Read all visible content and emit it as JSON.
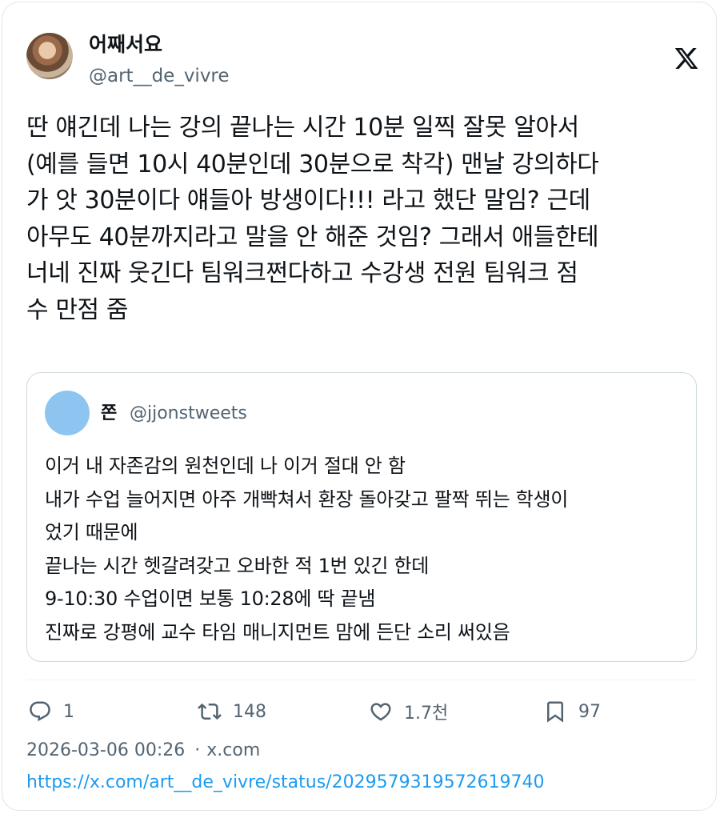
{
  "author": {
    "display_name": "어째서요",
    "handle": "@art__de_vivre"
  },
  "tweet": {
    "text": "딴 얘긴데 나는 강의 끝나는 시간 10분 일찍 잘못 알아서\n(예를 들면 10시 40분인데 30분으로 착각) 맨날 강의하다\n가 앗 30분이다 얘들아 방생이다!!! 라고 했단 말임? 근데\n아무도 40분까지라고 말을 안 해준 것임? 그래서 애들한테\n너네 진짜 웃긴다 팀워크쩐다하고 수강생 전원 팀워크 점\n수 만점 줌"
  },
  "quoted": {
    "display_name": "쫀",
    "handle": "@jjonstweets",
    "text": "이거 내 자존감의 원천인데 나 이거 절대 안 함\n내가 수업 늘어지면 아주 개빡쳐서 환장 돌아갖고 팔짝 뛰는 학생이\n었기 때문에\n끝나는 시간 헷갈려갖고 오바한 적 1번 있긴 한데\n9-10:30 수업이면 보통 10:28에 딱 끝냄\n진짜로 강평에 교수 타임 매니지먼트 맘에 든단 소리 써있음"
  },
  "actions": {
    "reply_count": "1",
    "retweet_count": "148",
    "like_count": "1.7천",
    "bookmark_count": "97"
  },
  "meta": {
    "timestamp": "2026-03-06 00:26",
    "separator": "·",
    "source": "x.com",
    "url": "https://x.com/art__de_vivre/status/2029579319572619740"
  },
  "icons": {
    "brand": "x-logo-icon",
    "reply": "reply-icon",
    "retweet": "retweet-icon",
    "like": "heart-icon",
    "bookmark": "bookmark-icon"
  },
  "colors": {
    "text": "#0f1419",
    "secondary": "#536471",
    "link": "#1d9bf0",
    "border": "#cfd9de",
    "quote_avatar": "#8ec5f0"
  }
}
